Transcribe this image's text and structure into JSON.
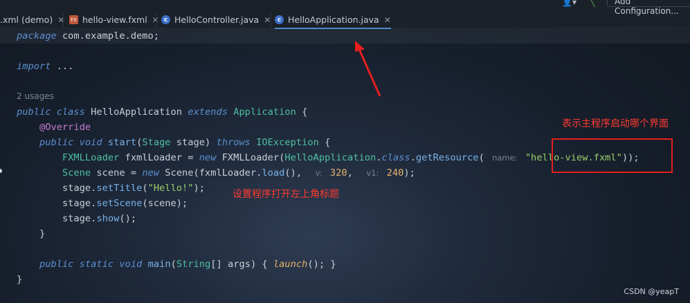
{
  "toolbar": {
    "add_config_label": "Add Configuration..."
  },
  "tabs": [
    {
      "label": ".xml (demo)",
      "icon": "xml-file-icon"
    },
    {
      "label": "hello-view.fxml",
      "icon": "fxml-file-icon"
    },
    {
      "label": "HelloController.java",
      "icon": "java-class-icon",
      "icon_color": "#3c6fc8"
    },
    {
      "label": "HelloApplication.java",
      "icon": "java-app-class-icon",
      "icon_color": "#3c6fc8",
      "active": true
    }
  ],
  "close_glyph": "✕",
  "code": {
    "package_kw": "package",
    "package_name": "com.example.demo;",
    "import_kw": "import",
    "import_rest": "...",
    "usages": "2 usages",
    "l5": {
      "kw1": "public",
      "kw2": "class",
      "name": "HelloApplication",
      "kw3": "extends",
      "parent": "Application",
      "brace": " {"
    },
    "l6": "@Override",
    "l7": {
      "kw1": "public",
      "kw2": "void",
      "method": "start",
      "p1": "(",
      "type": "Stage",
      "p2": " stage) ",
      "kw3": "throws",
      "exc": "IOException",
      "brace": " {"
    },
    "l8": {
      "type": "FXMLLoader",
      "var": " fxmlLoader = ",
      "kw": "new",
      "ctor": " FXMLLoader(",
      "cls": "HelloApplication",
      "dot": ".",
      "classkw": "class",
      "dot2": ".",
      "method": "getResource",
      "paren": "(",
      "hint": "name:",
      "str": "\"hello-view.fxml\"",
      "end": "));"
    },
    "l9": {
      "type": "Scene",
      "var": " scene = ",
      "kw": "new",
      "ctor": " Scene(fxmlLoader.",
      "method": "load",
      "rest": "(),",
      "hint1": "v:",
      "num1": "320",
      "comma": ",",
      "hint2": "v1:",
      "num2": "240",
      "end": ");"
    },
    "l10": {
      "obj": "stage.",
      "method": "setTitle",
      "p": "(",
      "str": "\"Hello!\"",
      "end": ");"
    },
    "l11": {
      "obj": "stage.",
      "method": "setScene",
      "end": "(scene);"
    },
    "l12": {
      "obj": "stage.",
      "method": "show",
      "end": "();"
    },
    "l13": "}",
    "l15": {
      "kw1": "public",
      "kw2": "static",
      "kw3": "void",
      "method": "main",
      "p1": "(",
      "type": "String",
      "rest": "[] args) { ",
      "call": "launch",
      "end": "(); }"
    },
    "l16": "}"
  },
  "annotations": {
    "note1": "表示主程序启动哪个界面",
    "note2": "设置程序打开左上角标题",
    "accent_red": "#ff3b30"
  },
  "watermark": "CSDN @yeapT"
}
